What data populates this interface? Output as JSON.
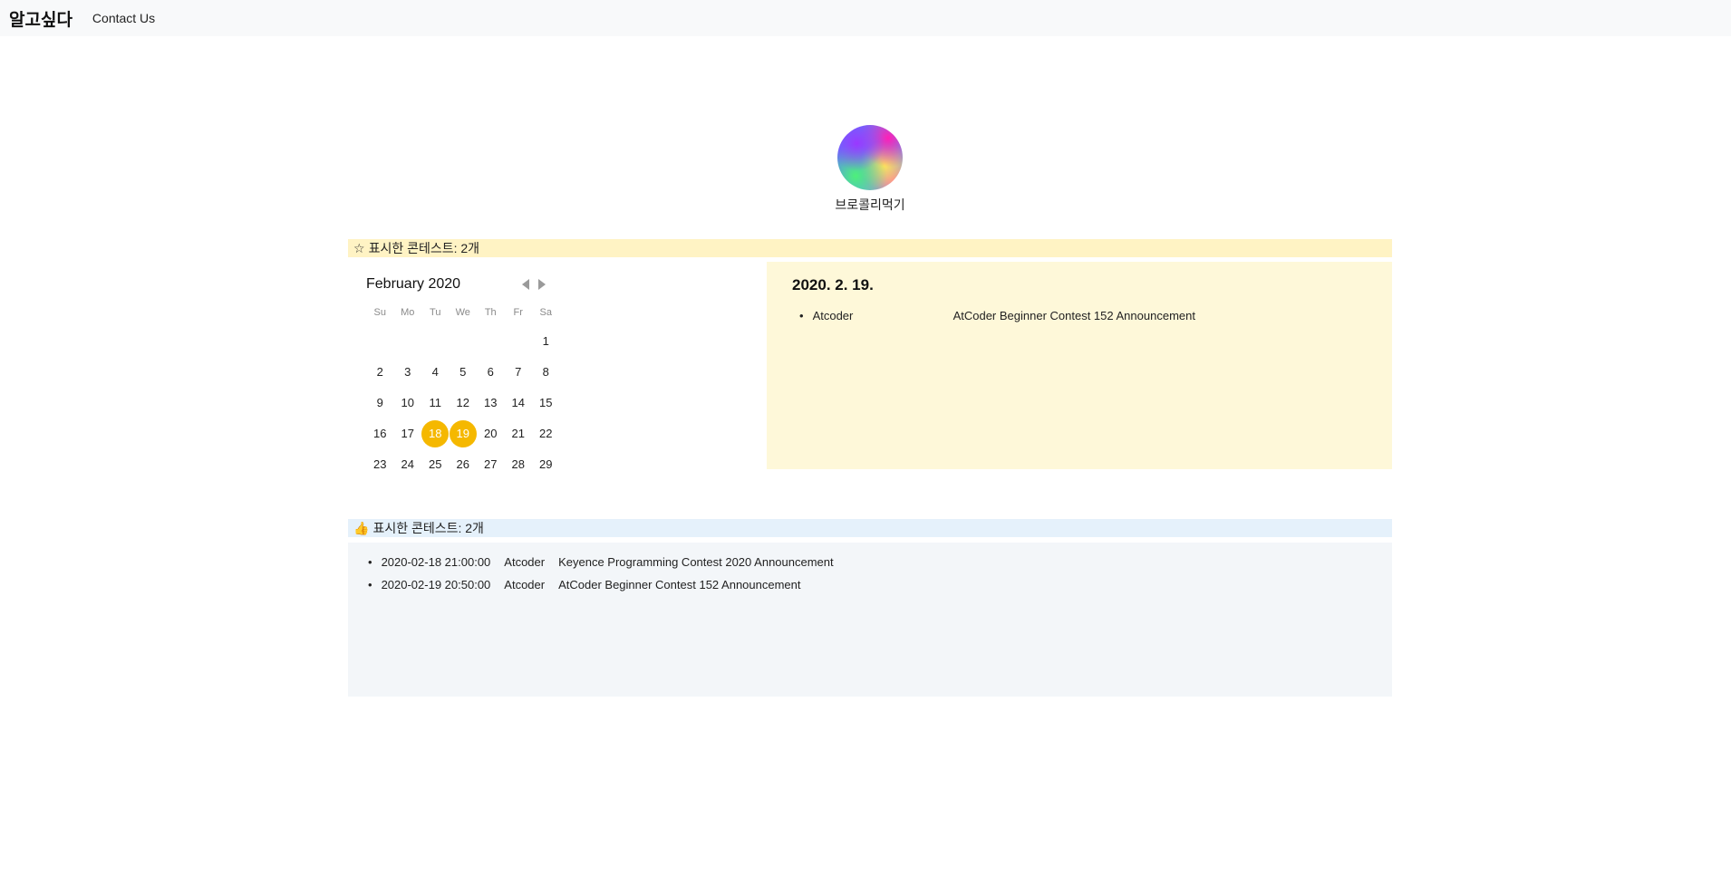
{
  "nav": {
    "brand": "알고싶다",
    "contact": "Contact Us"
  },
  "profile": {
    "username": "브로콜리먹기",
    "avatar_icon": "avatar-image"
  },
  "starred": {
    "header_icon": "star-icon",
    "header": "표시한 콘테스트: 2개",
    "calendar": {
      "month": "February 2020",
      "weekdays": [
        "Su",
        "Mo",
        "Tu",
        "We",
        "Th",
        "Fr",
        "Sa"
      ],
      "weeks": [
        [
          "",
          "",
          "",
          "",
          "",
          "",
          "1"
        ],
        [
          "2",
          "3",
          "4",
          "5",
          "6",
          "7",
          "8"
        ],
        [
          "9",
          "10",
          "11",
          "12",
          "13",
          "14",
          "15"
        ],
        [
          "16",
          "17",
          "18",
          "19",
          "20",
          "21",
          "22"
        ],
        [
          "23",
          "24",
          "25",
          "26",
          "27",
          "28",
          "29"
        ]
      ],
      "marked": [
        "18",
        "19"
      ],
      "marked_color": "#f5b800"
    },
    "selected": {
      "date": "2020. 2. 19.",
      "items": [
        {
          "site": "Atcoder",
          "name": "AtCoder Beginner Contest 152 Announcement"
        }
      ]
    }
  },
  "liked": {
    "header_icon": "thumbs-up-icon",
    "header": "표시한 콘테스트: 2개",
    "items": [
      {
        "time": "2020-02-18 21:00:00",
        "site": "Atcoder",
        "name": "Keyence Programming Contest 2020 Announcement"
      },
      {
        "time": "2020-02-19 20:50:00",
        "site": "Atcoder",
        "name": "AtCoder Beginner Contest 152 Announcement"
      }
    ]
  }
}
